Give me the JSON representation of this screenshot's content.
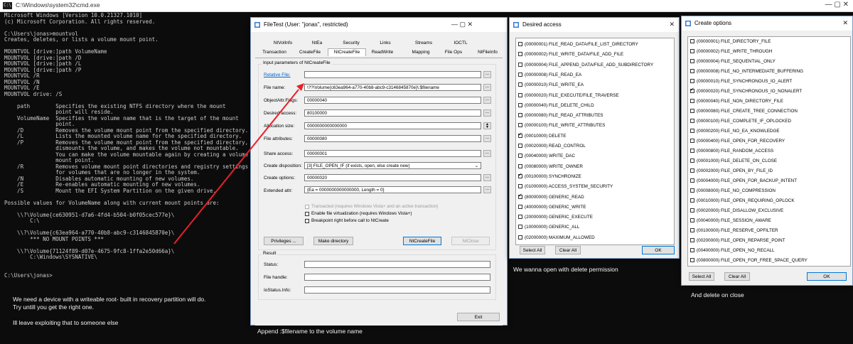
{
  "cmd": {
    "title": "C:\\Windows\\system32\\cmd.exe",
    "icon_label": "C:\\",
    "controls": "—   ▢   ✕",
    "lines": [
      "Microsoft Windows [Version 10.0.21327.1010]",
      "(c) Microsoft Corporation. All rights reserved.",
      "",
      "C:\\Users\\jonas>mountvol",
      "Creates, deletes, or lists a volume mount point.",
      "",
      "MOUNTVOL [drive:]path VolumeName",
      "MOUNTVOL [drive:]path /D",
      "MOUNTVOL [drive:]path /L",
      "MOUNTVOL [drive:]path /P",
      "MOUNTVOL /R",
      "MOUNTVOL /N",
      "MOUNTVOL /E",
      "MOUNTVOL drive: /S",
      "",
      "    path        Specifies the existing NTFS directory where the mount",
      "                point will reside.",
      "    VolumeName  Specifies the volume name that is the target of the mount",
      "                point.",
      "    /D          Removes the volume mount point from the specified directory.",
      "    /L          Lists the mounted volume name for the specified directory.",
      "    /P          Removes the volume mount point from the specified directory,",
      "                dismounts the volume, and makes the volume not mountable.",
      "                You can make the volume mountable again by creating a volume",
      "                mount point.",
      "    /R          Removes volume mount point directories and registry settings",
      "                for volumes that are no longer in the system.",
      "    /N          Disables automatic mounting of new volumes.",
      "    /E          Re-enables automatic mounting of new volumes.",
      "    /S          Mount the EFI System Partition on the given drive.",
      "",
      "Possible values for VolumeName along with current mount points are:",
      "",
      "    \\\\?\\Volume{ce630951-d7a6-4fd4-b504-b0f05cec577e}\\",
      "        C:\\",
      "",
      "    \\\\?\\Volume{c63ea964-a770-40b8-abc9-c3146845870e}\\",
      "        *** NO MOUNT POINTS ***",
      "",
      "    \\\\?\\Volume{71124f89-d07e-4675-9fc8-1ffa2e50d66a}\\",
      "        C:\\Windows\\SYSNATIVE\\",
      "",
      "",
      "C:\\Users\\jonas>"
    ]
  },
  "notes": {
    "left": "We need a device with a writeable root- built in recovery partition will do.\nTry untill you get the right one.\n\nIll leave exploiting that to someone else",
    "append": "Append :$filename to the volume name",
    "delete_perm": "We wanna open with delete permission",
    "delete_close": "And delete on close"
  },
  "filetest": {
    "title": "FileTest (User: \"jonas\", restricted)",
    "controls": "—      ▢      ✕",
    "tabs_top": [
      "NtVolInfo",
      "NtEa",
      "Security",
      "Links",
      "Streams",
      "IOCTL"
    ],
    "tabs_bottom": [
      "Transaction",
      "CreateFile",
      "NtCreateFile",
      "ReadWrite",
      "Mapping",
      "File Ops",
      "NtFileInfo"
    ],
    "group_input": "Input parameters of NtCreateFile",
    "fields": [
      {
        "label": "Relative File:",
        "value": ""
      },
      {
        "label": "File name:",
        "value": "\\??\\Volume{c63ea964-a770-40b8-abc9-c3146845870e}\\:$filename"
      },
      {
        "label": "ObjectAttr.Flags:",
        "value": "00000040"
      },
      {
        "label": "Desired access:",
        "value": "80100000"
      },
      {
        "label": "Allocation size:",
        "value": "0000000000000000"
      },
      {
        "label": "File attributes:",
        "value": "00000080"
      },
      {
        "label": "Share access:",
        "value": "00000001"
      }
    ],
    "disposition_label": "Create disposition:",
    "disposition_value": "[3] FILE_OPEN_IF (if exists, open, else create new)",
    "options_label": "Create options:",
    "options_value": "00000020",
    "extattr_label": "Extended attr:",
    "extattr_value": "{Ea = 0000000000000000, Length = 0}",
    "dots": "...",
    "checks": [
      {
        "label": "Transacted (requires Windows Vista+ and an active transaction)",
        "checked": false,
        "disabled": true
      },
      {
        "label": "Enable file virtualization (requires Windows Vista+)",
        "checked": false,
        "disabled": false
      },
      {
        "label": "Breakpoint right before call to NtCreate",
        "checked": false,
        "disabled": false
      }
    ],
    "buttons": {
      "privileges": "Privileges ...",
      "make_dir": "Make directory",
      "ntcreate": "NtCreateFile",
      "ntclose": "NtClose"
    },
    "group_result": "Result",
    "result_labels": [
      "Status:",
      "File handle:",
      "IoStatus.Info:"
    ],
    "exit": "Exit"
  },
  "desired_access": {
    "title": "Desired access",
    "close": "✕",
    "items": [
      {
        "label": "(00000001) FILE_READ_DATA/FILE_LIST_DIRECTORY",
        "checked": false
      },
      {
        "label": "(00000002) FILE_WRITE_DATA/FILE_ADD_FILE",
        "checked": false
      },
      {
        "label": "(00000004) FILE_APPEND_DATA/FILE_ADD_SUBDIRECTORY",
        "checked": false
      },
      {
        "label": "(00000008) FILE_READ_EA",
        "checked": false
      },
      {
        "label": "(00000010) FILE_WRITE_EA",
        "checked": false
      },
      {
        "label": "(00000020) FILE_EXECUTE/FILE_TRAVERSE",
        "checked": false
      },
      {
        "label": "(00000040) FILE_DELETE_CHILD",
        "checked": false
      },
      {
        "label": "(00000080) FILE_READ_ATTRIBUTES",
        "checked": false
      },
      {
        "label": "(00000100) FILE_WRITE_ATTRIBUTES",
        "checked": false
      },
      {
        "label": "(00010000) DELETE",
        "checked": true
      },
      {
        "label": "(00020000) READ_CONTROL",
        "checked": false
      },
      {
        "label": "(00040000) WRITE_DAC",
        "checked": false
      },
      {
        "label": "(00080000) WRITE_OWNER",
        "checked": false
      },
      {
        "label": "(00100000) SYNCHRONIZE",
        "checked": true
      },
      {
        "label": "(01000000) ACCESS_SYSTEM_SECURITY",
        "checked": false
      },
      {
        "label": "(80000000) GENERIC_READ",
        "checked": true
      },
      {
        "label": "(40000000) GENERIC_WRITE",
        "checked": false
      },
      {
        "label": "(20000000) GENERIC_EXECUTE",
        "checked": false
      },
      {
        "label": "(10000000) GENERIC_ALL",
        "checked": false
      },
      {
        "label": "(02000000) MAXIMUM_ALLOWED",
        "checked": false
      }
    ],
    "select_all": "Select All",
    "clear_all": "Clear All",
    "ok": "OK"
  },
  "create_options": {
    "title": "Create options",
    "close": "✕",
    "items": [
      {
        "label": "(00000001) FILE_DIRECTORY_FILE",
        "checked": false
      },
      {
        "label": "(00000002) FILE_WRITE_THROUGH",
        "checked": false
      },
      {
        "label": "(00000004) FILE_SEQUENTIAL_ONLY",
        "checked": false
      },
      {
        "label": "(00000008) FILE_NO_INTERMEDIATE_BUFFERING",
        "checked": false
      },
      {
        "label": "(00000010) FILE_SYNCHRONOUS_IO_ALERT",
        "checked": false
      },
      {
        "label": "(00000020) FILE_SYNCHRONOUS_IO_NONALERT",
        "checked": true
      },
      {
        "label": "(00000040) FILE_NON_DIRECTORY_FILE",
        "checked": false
      },
      {
        "label": "(00000080) FILE_CREATE_TREE_CONNECTION",
        "checked": false
      },
      {
        "label": "(00000100) FILE_COMPLETE_IF_OPLOCKED",
        "checked": false
      },
      {
        "label": "(00000200) FILE_NO_EA_KNOWLEDGE",
        "checked": false
      },
      {
        "label": "(00000400) FILE_OPEN_FOR_RECOVERY",
        "checked": false
      },
      {
        "label": "(00000800) FILE_RANDOM_ACCESS",
        "checked": false
      },
      {
        "label": "(00001000) FILE_DELETE_ON_CLOSE",
        "checked": false
      },
      {
        "label": "(00002000) FILE_OPEN_BY_FILE_ID",
        "checked": false
      },
      {
        "label": "(00004000) FILE_OPEN_FOR_BACKUP_INTENT",
        "checked": false
      },
      {
        "label": "(00008000) FILE_NO_COMPRESSION",
        "checked": false
      },
      {
        "label": "(00010000) FILE_OPEN_REQUIRING_OPLOCK",
        "checked": false
      },
      {
        "label": "(00020000) FILE_DISALLOW_EXCLUSIVE",
        "checked": false
      },
      {
        "label": "(00040000) FILE_SESSION_AWARE",
        "checked": false
      },
      {
        "label": "(00100000) FILE_RESERVE_OPFILTER",
        "checked": false
      },
      {
        "label": "(00200000) FILE_OPEN_REPARSE_POINT",
        "checked": false
      },
      {
        "label": "(00400000) FILE_OPEN_NO_RECALL",
        "checked": false
      },
      {
        "label": "(00800000) FILE_OPEN_FOR_FREE_SPACE_QUERY",
        "checked": false
      }
    ],
    "select_all": "Select All",
    "clear_all": "Clear All",
    "ok": "OK"
  },
  "colors": {
    "arrow": "#e8202a",
    "console_text": "#cccccc",
    "link": "#0066cc"
  }
}
